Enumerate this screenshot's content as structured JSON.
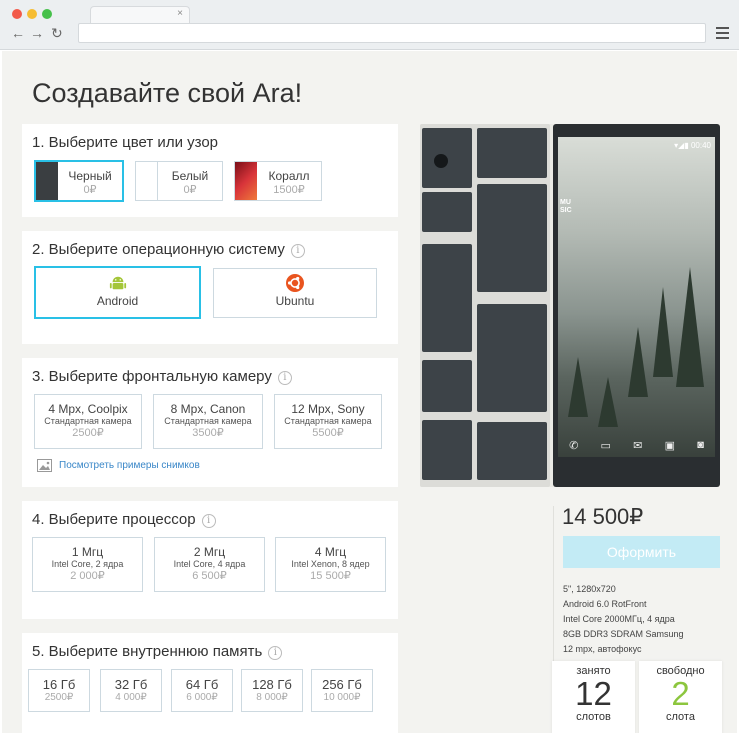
{
  "browser": {
    "back_icon": "←",
    "forward_icon": "→",
    "reload_icon": "↻",
    "tab_close": "×"
  },
  "page_title": "Создавайте свой Ara!",
  "color_section": {
    "title": "1. Выберите цвет или узор",
    "options": [
      {
        "label": "Черный",
        "price": "0₽",
        "swatch": "#3a3e41"
      },
      {
        "label": "Белый",
        "price": "0₽",
        "swatch": "#ffffff"
      },
      {
        "label": "Коралл",
        "price": "1500₽",
        "swatch": "#c0262e"
      }
    ]
  },
  "os_section": {
    "title": "2. Выберите операционную систему",
    "info": "i",
    "options": [
      {
        "label": "Android",
        "icon": "android-icon"
      },
      {
        "label": "Ubuntu",
        "icon": "ubuntu-icon"
      }
    ]
  },
  "camera_section": {
    "title": "3. Выберите фронтальную камеру",
    "info": "i",
    "options": [
      {
        "label": "4 Mpx, Coolpix",
        "sub": "Стандартная камера",
        "price": "2500₽"
      },
      {
        "label": "8 Mpx, Canon",
        "sub": "Стандартная камера",
        "price": "3500₽"
      },
      {
        "label": "12 Mpx, Sony",
        "sub": "Стандартная камера",
        "price": "5500₽"
      }
    ],
    "samples_link": "Посмотреть примеры снимков"
  },
  "cpu_section": {
    "title": "4. Выберите процессор",
    "info": "i",
    "options": [
      {
        "label": "1 Мгц",
        "sub": "Intel Core, 2 ядра",
        "price": "2 000₽"
      },
      {
        "label": "2 Мгц",
        "sub": "Intel Core, 4 ядра",
        "price": "6 500₽"
      },
      {
        "label": "4 Мгц",
        "sub": "Intel Xenon, 8 ядер",
        "price": "15 500₽"
      }
    ]
  },
  "memory_section": {
    "title": "5. Выберите внутреннюю память",
    "info": "i",
    "options": [
      {
        "label": "16 Гб",
        "price": "2500₽"
      },
      {
        "label": "32 Гб",
        "price": "4 000₽"
      },
      {
        "label": "64 Гб",
        "price": "6 000₽"
      },
      {
        "label": "128 Гб",
        "price": "8 000₽"
      },
      {
        "label": "256 Гб",
        "price": "10 000₽"
      }
    ]
  },
  "phone": {
    "time": "00:40",
    "signal": "▾◢▮",
    "music_label_1": "MU",
    "music_label_2": "SIC",
    "dock_icons": [
      "phone-icon",
      "chat-icon",
      "mail-icon",
      "gallery-icon",
      "camera-icon"
    ]
  },
  "summary": {
    "total": "14 500₽",
    "order_button": "Оформить",
    "specs": [
      "5\", 1280x720",
      "Android 6.0 RotFront",
      "Intel Core 2000МГц, 4 ядра",
      "8GB DDR3 SDRAM Samsung",
      "12 mpx, автофокус"
    ],
    "occupied": {
      "top": "занято",
      "num": "12",
      "bottom": "слотов"
    },
    "free": {
      "top": "свободно",
      "num": "2",
      "bottom": "слота"
    }
  },
  "colors": {
    "accent": "#29c0e6",
    "android_green": "#a4c639",
    "ubuntu_orange": "#e9541f",
    "link_blue": "#3a87c8",
    "free_green": "#8cc63e"
  }
}
